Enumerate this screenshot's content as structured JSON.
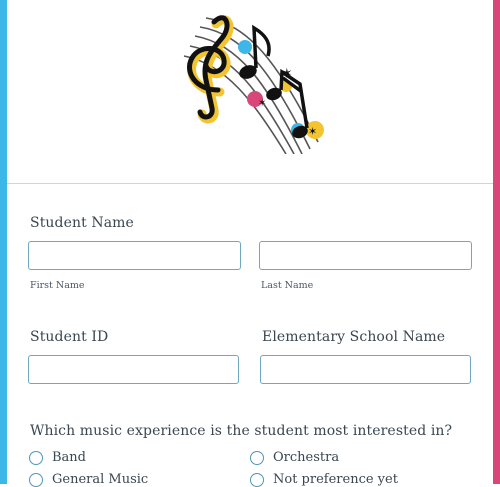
{
  "form": {
    "student_name": {
      "label": "Student Name",
      "first": {
        "sublabel": "First Name",
        "value": "",
        "placeholder": ""
      },
      "last": {
        "sublabel": "Last Name",
        "value": "",
        "placeholder": ""
      }
    },
    "student_id": {
      "label": "Student ID",
      "value": ""
    },
    "school_name": {
      "label": "Elementary School Name",
      "value": ""
    },
    "interest": {
      "question": "Which music experience is the student most interested in?",
      "options": [
        "Band",
        "Orchestra",
        "General Music",
        "Not preference yet"
      ]
    }
  },
  "colors": {
    "left_edge": "#3db6e8",
    "right_edge": "#d9477a",
    "field_border": "#6fa8bf"
  },
  "header": {
    "logo_icon": "music-notes-icon"
  }
}
